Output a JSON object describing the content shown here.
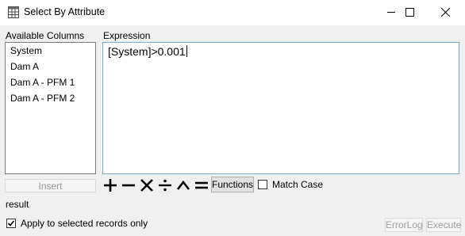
{
  "window": {
    "title": "Select By Attribute"
  },
  "columns": {
    "label": "Available Columns",
    "items": [
      "System",
      "Dam A",
      "Dam A - PFM 1",
      "Dam A - PFM 2"
    ]
  },
  "expression": {
    "label": "Expression",
    "value": "[System]>0.001"
  },
  "insert_button": "Insert",
  "operators": [
    "plus",
    "minus",
    "multiply",
    "divide",
    "power",
    "equals"
  ],
  "functions_button": "Functions",
  "match_case": {
    "label": "Match Case",
    "checked": false
  },
  "result_label": "result",
  "apply_selected": {
    "label": "Apply to selected records only",
    "checked": true
  },
  "errorlog_button": "ErrorLog",
  "execute_button": "Execute"
}
